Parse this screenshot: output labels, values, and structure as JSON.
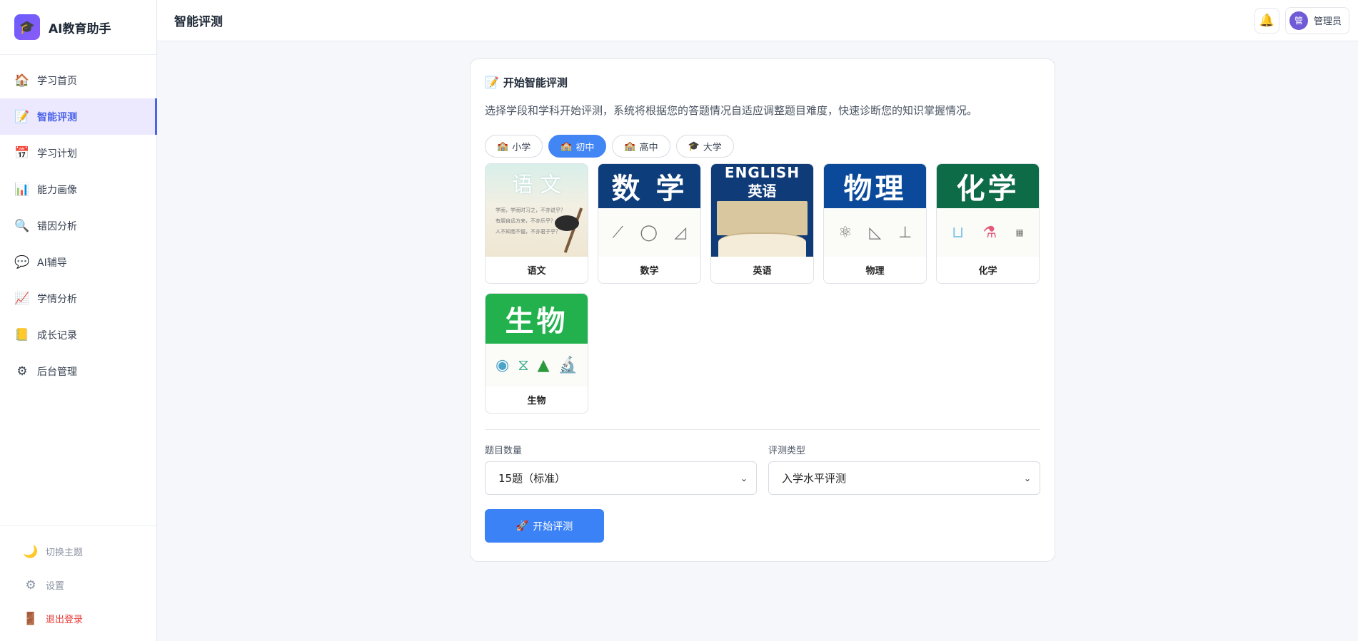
{
  "brand": {
    "title": "AI教育助手",
    "logo_icon": "🎓"
  },
  "sidebar": {
    "items": [
      {
        "label": "学习首页",
        "icon": "🏠",
        "name": "home"
      },
      {
        "label": "智能评测",
        "icon": "📝",
        "name": "assessment",
        "active": true
      },
      {
        "label": "学习计划",
        "icon": "📅",
        "name": "plan"
      },
      {
        "label": "能力画像",
        "icon": "📊",
        "name": "profile"
      },
      {
        "label": "错因分析",
        "icon": "🔍",
        "name": "error-analysis"
      },
      {
        "label": "AI辅导",
        "icon": "💬",
        "name": "ai-tutor"
      },
      {
        "label": "学情分析",
        "icon": "📈",
        "name": "learning-analysis"
      },
      {
        "label": "成长记录",
        "icon": "📒",
        "name": "growth"
      },
      {
        "label": "后台管理",
        "icon": "⚙",
        "name": "admin"
      }
    ],
    "bottom": [
      {
        "label": "切换主题",
        "icon": "🌙",
        "name": "theme"
      },
      {
        "label": "设置",
        "icon": "⚙",
        "name": "settings"
      },
      {
        "label": "退出登录",
        "icon": "🚪",
        "name": "logout"
      }
    ]
  },
  "header": {
    "title": "智能评测",
    "bell_icon": "🔔",
    "avatar_text": "管",
    "user_name": "管理员"
  },
  "assessment": {
    "title": "开始智能评测",
    "title_icon": "📝",
    "description": "选择学段和学科开始评测，系统将根据您的答题情况自适应调整题目难度，快速诊断您的知识掌握情况。",
    "stages": [
      {
        "label": "小学",
        "icon": "🏫"
      },
      {
        "label": "初中",
        "icon": "🏫",
        "active": true
      },
      {
        "label": "高中",
        "icon": "🏫"
      },
      {
        "label": "大学",
        "icon": "🎓"
      }
    ],
    "subjects": [
      {
        "name": "语文",
        "cover_title": "语 文",
        "cover_lines": [
          "学而，学而时习之，不亦说乎？",
          "有朋自远方来，不亦乐乎？",
          "人不知而不愠，不亦君子乎？"
        ]
      },
      {
        "name": "数学",
        "cover_title": "数 学",
        "cover_color": "#0d3d7a"
      },
      {
        "name": "英语",
        "cover_top": "ENGLISH",
        "cover_title": "英语"
      },
      {
        "name": "物理",
        "cover_title": "物理",
        "cover_color": "#0b4a9b"
      },
      {
        "name": "化学",
        "cover_title": "化学",
        "cover_color": "#0d6b48"
      },
      {
        "name": "生物",
        "cover_title": "生物",
        "cover_color": "#22b14c"
      }
    ],
    "question_count": {
      "label": "题目数量",
      "value": "15题（标准）"
    },
    "assessment_type": {
      "label": "评测类型",
      "value": "入学水平评测"
    },
    "start_button": {
      "label": "开始评测",
      "icon": "🚀"
    }
  }
}
